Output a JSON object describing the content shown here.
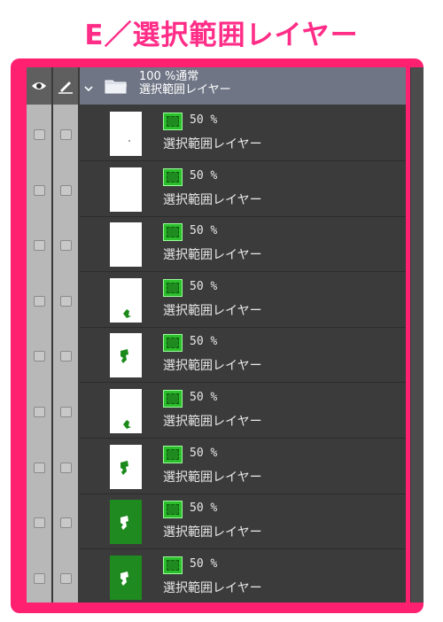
{
  "page": {
    "title": "E／選択範囲レイヤー"
  },
  "header": {
    "eye_icon": "eye-icon",
    "pen_icon": "pen-icon"
  },
  "folder": {
    "line1": "100 %通常",
    "line2": "選択範囲レイヤー",
    "chevron_icon": "chevron-down-icon",
    "folder_icon": "folder-icon"
  },
  "layers": [
    {
      "opacity": "50 %",
      "name": "選択範囲レイヤー",
      "thumb": "white-dot"
    },
    {
      "opacity": "50 %",
      "name": "選択範囲レイヤー",
      "thumb": "white"
    },
    {
      "opacity": "50 %",
      "name": "選択範囲レイヤー",
      "thumb": "white"
    },
    {
      "opacity": "50 %",
      "name": "選択範囲レイヤー",
      "thumb": "white-small-green"
    },
    {
      "opacity": "50 %",
      "name": "選択範囲レイヤー",
      "thumb": "white-green"
    },
    {
      "opacity": "50 %",
      "name": "選択範囲レイヤー",
      "thumb": "white-small-green"
    },
    {
      "opacity": "50 %",
      "name": "選択範囲レイヤー",
      "thumb": "white-green"
    },
    {
      "opacity": "50 %",
      "name": "選択範囲レイヤー",
      "thumb": "green-white"
    },
    {
      "opacity": "50 %",
      "name": "選択範囲レイヤー",
      "thumb": "green-white"
    }
  ],
  "colors": {
    "accent": "#ff2070",
    "title": "#ff2d87",
    "panel": "#3b3b3b",
    "folder_row": "#6f7585",
    "selection_green": "#2bbd2b"
  }
}
